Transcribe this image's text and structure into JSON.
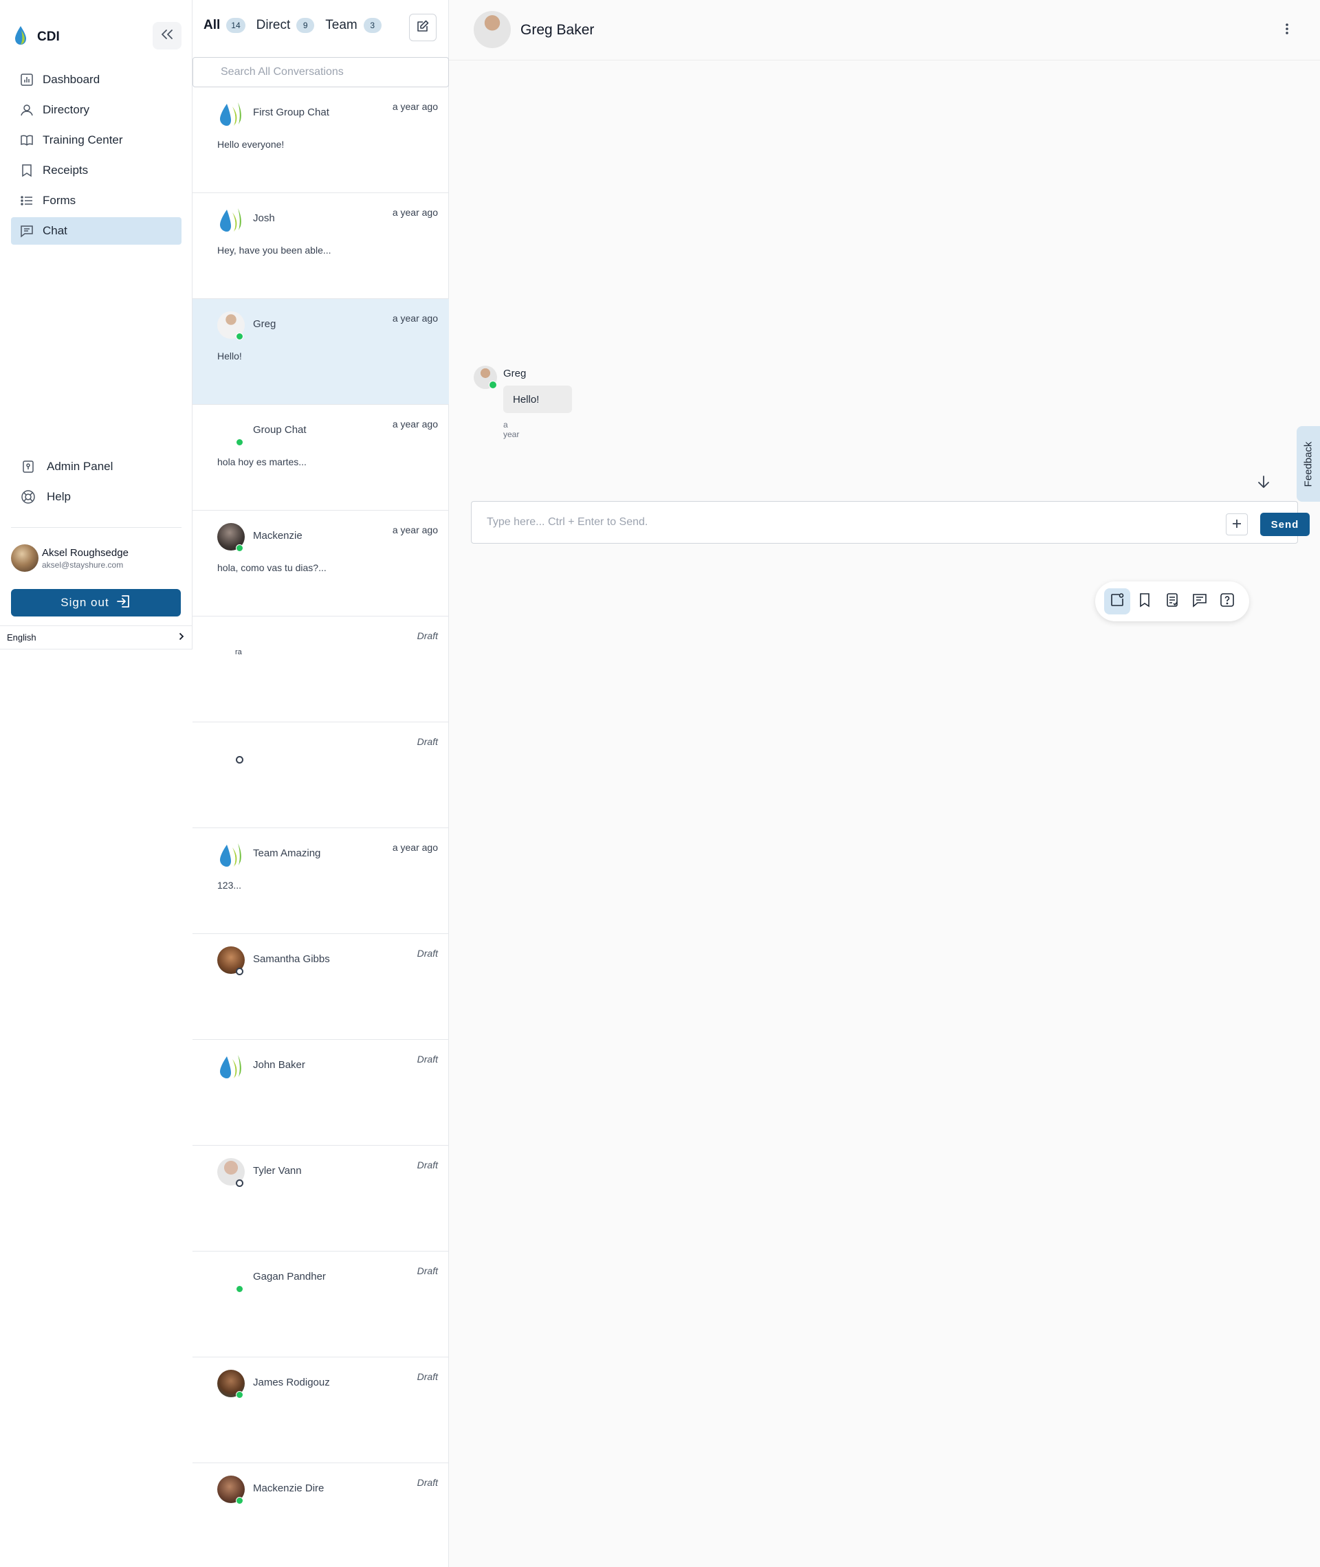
{
  "app": {
    "name": "CDI"
  },
  "sidebar": {
    "items": [
      {
        "label": "Dashboard",
        "icon": "chart-icon"
      },
      {
        "label": "Directory",
        "icon": "user-icon"
      },
      {
        "label": "Training Center",
        "icon": "book-icon"
      },
      {
        "label": "Receipts",
        "icon": "bookmark-icon"
      },
      {
        "label": "Forms",
        "icon": "list-icon"
      },
      {
        "label": "Chat",
        "icon": "chat-icon",
        "active": true
      }
    ],
    "secondary": [
      {
        "label": "Admin Panel",
        "icon": "admin-icon"
      },
      {
        "label": "Help",
        "icon": "lifebuoy-icon"
      }
    ],
    "user": {
      "name": "Aksel Roughsedge",
      "email": "aksel@stayshure.com"
    },
    "signout_label": "Sign out",
    "language": "English"
  },
  "conversations": {
    "tabs": [
      {
        "label": "All",
        "count": "14"
      },
      {
        "label": "Direct",
        "count": "9"
      },
      {
        "label": "Team",
        "count": "3"
      }
    ],
    "search_placeholder": "Search All Conversations",
    "items": [
      {
        "name": "First Group Chat",
        "time": "a year ago",
        "preview": "Hello everyone!"
      },
      {
        "name": "Josh",
        "time": "a year ago",
        "preview": "Hey, have you been able..."
      },
      {
        "name": "Greg",
        "time": "a year ago",
        "preview": "Hello!"
      },
      {
        "name": "Group Chat",
        "time": "a year ago",
        "preview": "hola hoy es martes..."
      },
      {
        "name": "Mackenzie",
        "time": "a year ago",
        "preview": "hola, como vas tu dias?..."
      },
      {
        "name": "",
        "time": "Draft",
        "preview": "",
        "glyph": "ra"
      },
      {
        "name": "",
        "time": "Draft",
        "preview": ""
      },
      {
        "name": "Team Amazing",
        "time": "a year ago",
        "preview": "123..."
      },
      {
        "name": "Samantha Gibbs",
        "time": "Draft",
        "preview": ""
      },
      {
        "name": "John Baker",
        "time": "Draft",
        "preview": ""
      },
      {
        "name": "Tyler Vann",
        "time": "Draft",
        "preview": ""
      },
      {
        "name": "Gagan Pandher",
        "time": "Draft",
        "preview": ""
      },
      {
        "name": "James Rodigouz",
        "time": "Draft",
        "preview": ""
      },
      {
        "name": "Mackenzie Dire",
        "time": "Draft",
        "preview": ""
      }
    ]
  },
  "chat": {
    "contact_name": "Greg Baker",
    "messages": [
      {
        "sender": "Greg",
        "text": "Hello!",
        "time": "a year"
      }
    ],
    "input_placeholder": "Type here... Ctrl + Enter to Send.",
    "send_label": "Send",
    "feedback_label": "Feedback",
    "toolbar_icons": [
      "contact-card-icon",
      "bookmark-icon",
      "receipt-icon",
      "chat-icon",
      "help-icon"
    ]
  },
  "colors": {
    "primary": "#125b91",
    "active_nav": "#d3e5f3",
    "active_row": "#e3eff8",
    "online": "#22c55e"
  }
}
